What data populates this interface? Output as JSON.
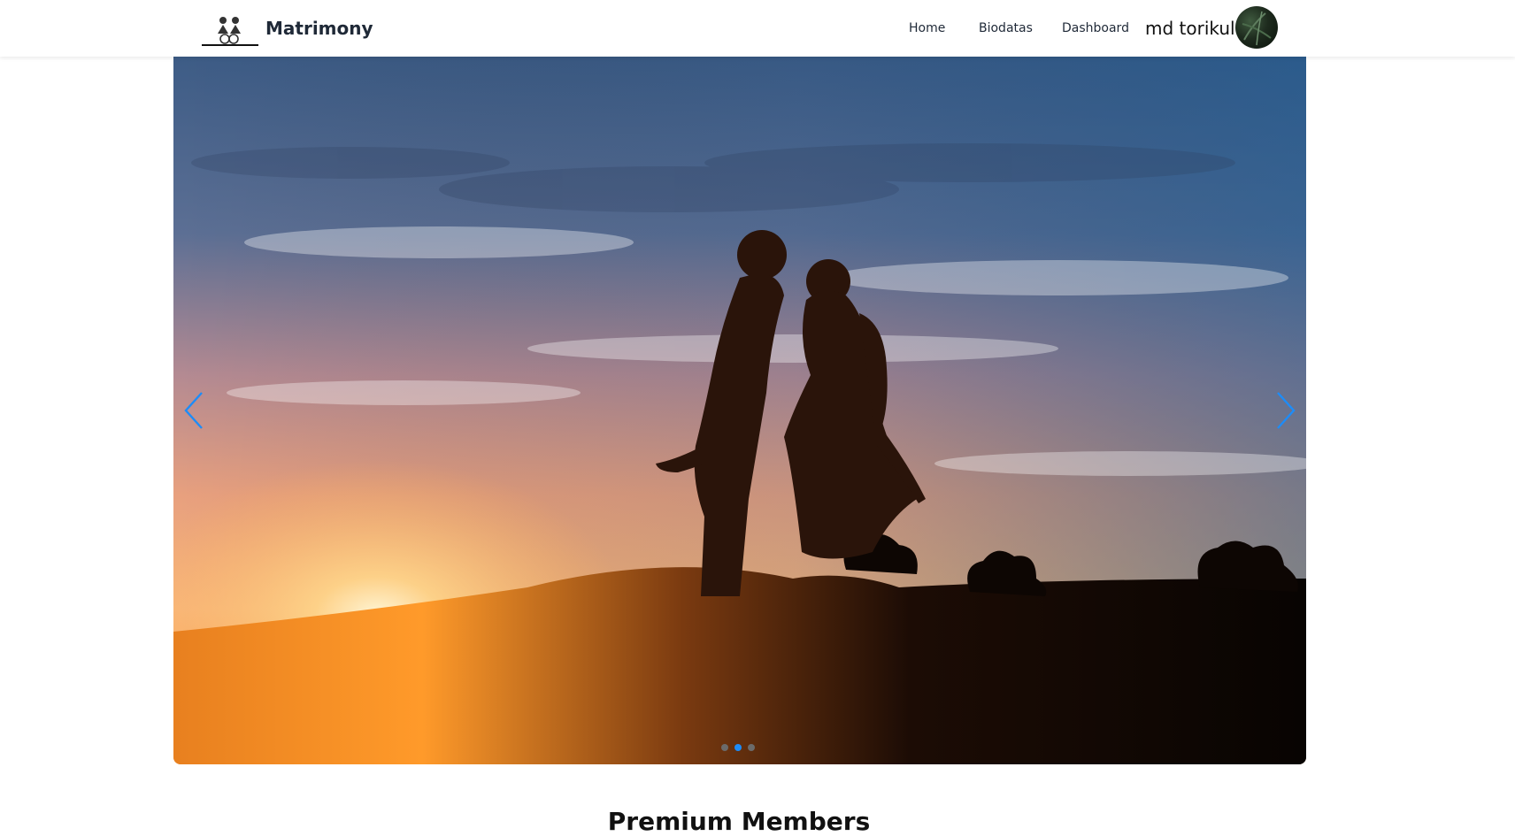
{
  "navbar": {
    "brand": "Matrimony",
    "links": {
      "home": "Home",
      "biodatas": "Biodatas",
      "dashboard": "Dashboard"
    },
    "username": "md torikul"
  },
  "carousel": {
    "slide_count": 3,
    "active_slide": 2
  },
  "sections": {
    "premium_title": "Premium Members"
  },
  "colors": {
    "accent": "#1d8cf8",
    "text": "#1f2937"
  }
}
